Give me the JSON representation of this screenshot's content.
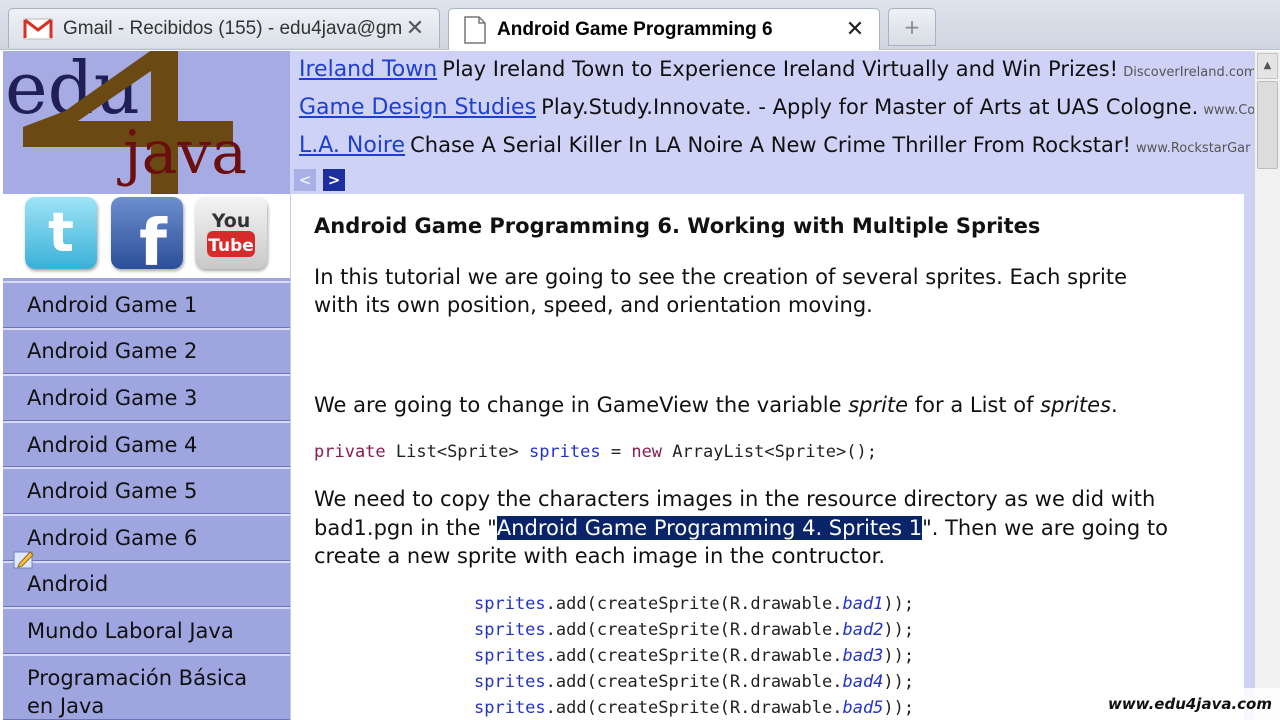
{
  "browser": {
    "tabs": [
      {
        "title": "Gmail - Recibidos (155) - edu4java@gm...",
        "active": false
      },
      {
        "title": "Android Game Programming 6",
        "active": true
      }
    ],
    "close_glyph": "✕",
    "new_tab_glyph": "+"
  },
  "logo": {
    "line1": "edu",
    "line2": "java",
    "number": "4"
  },
  "social": [
    {
      "name": "twitter",
      "label": "t"
    },
    {
      "name": "facebook",
      "label": "f"
    },
    {
      "name": "youtube",
      "label_top": "You",
      "label_bottom": "Tube"
    }
  ],
  "ads": [
    {
      "title": "Ireland Town",
      "description": "Play Ireland Town to Experience Ireland Virtually and Win Prizes!",
      "url": "DiscoverIreland.com"
    },
    {
      "title": "Game Design Studies",
      "description": "Play.Study.Innovate. - Apply for Master of Arts at UAS Cologne.",
      "url": "www.Col"
    },
    {
      "title": "L.A. Noire",
      "description": "Chase A Serial Killer In LA Noire A New Crime Thriller From Rockstar!",
      "url": "www.RockstarGar"
    }
  ],
  "ad_nav": {
    "prev": "<",
    "next": ">"
  },
  "sidebar": {
    "items": [
      {
        "label": "Android Game 1"
      },
      {
        "label": "Android Game 2"
      },
      {
        "label": "Android Game 3"
      },
      {
        "label": "Android Game 4"
      },
      {
        "label": "Android Game 5"
      },
      {
        "label": "Android Game 6"
      },
      {
        "label": "Android"
      },
      {
        "label": "Mundo Laboral Java"
      },
      {
        "label": "Programación  Básica",
        "label2": "en Java"
      }
    ]
  },
  "article": {
    "title": "Android Game Programming 6. Working with Multiple Sprites",
    "intro_line1": "In this tutorial we are going to see the creation of several sprites. Each sprite",
    "intro_line2": "with its own position, speed, and orientation moving.",
    "change_pre": "We are going to change in GameView the variable ",
    "change_var1": "sprite",
    "change_mid": " for a List of ",
    "change_var2": "sprites",
    "change_end": ".",
    "code1": {
      "kw1": "private",
      "type1": " List<Sprite> ",
      "var": "sprites",
      "eq": " = ",
      "kw2": "new",
      "rest": " ArrayList<Sprite>();"
    },
    "copy_line1": "We need to copy the characters images in the resource directory as we did with",
    "copy_line2_pre": "bad1.pgn in the \"",
    "copy_line2_sel": "Android Game Programming 4. Sprites 1",
    "copy_line2_post": "\". Then we are going to",
    "copy_line3": "create a new sprite with each image in the contructor.",
    "code_lines": [
      {
        "var": "sprites",
        "mid": ".add(createSprite(R.drawable.",
        "res": "bad1",
        "end": "));"
      },
      {
        "var": "sprites",
        "mid": ".add(createSprite(R.drawable.",
        "res": "bad2",
        "end": "));"
      },
      {
        "var": "sprites",
        "mid": ".add(createSprite(R.drawable.",
        "res": "bad3",
        "end": "));"
      },
      {
        "var": "sprites",
        "mid": ".add(createSprite(R.drawable.",
        "res": "bad4",
        "end": "));"
      },
      {
        "var": "sprites",
        "mid": ".add(createSprite(R.drawable.",
        "res": "bad5",
        "end": "));"
      }
    ]
  },
  "watermark": "www.edu4java.com",
  "colors": {
    "sidebar": "#9ea5df",
    "ad_bg": "#ced2f6",
    "link": "#1f3fd1",
    "selection": "#0a246a"
  }
}
